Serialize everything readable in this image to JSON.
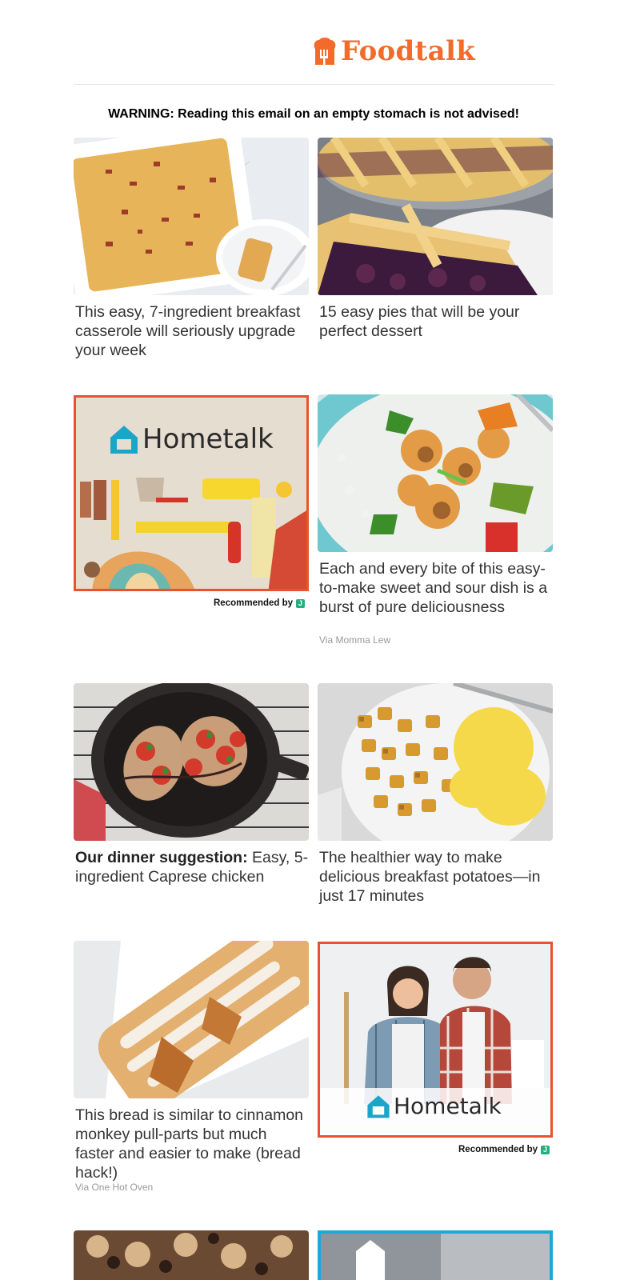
{
  "brand": {
    "name": "Foodtalk",
    "color": "#f26b2b"
  },
  "warning": "WARNING: Reading this email on an empty stomach is not advised!",
  "cards": {
    "casserole": {
      "title": "This easy, 7-ingredient breakfast casserole will seriously upgrade your week"
    },
    "pies": {
      "title": "15 easy pies that will be your perfect dessert"
    },
    "shrimp": {
      "title": "Each and every bite of this easy-to-make sweet and sour dish is a burst of pure deliciousness",
      "via": "Via Momma Lew"
    },
    "chicken": {
      "title_bold": "Our dinner suggestion:",
      "title_rest": " Easy, 5-ingredient Caprese chicken"
    },
    "potatoes": {
      "title": "The healthier way to make delicious breakfast potatoes—in just 17 minutes"
    },
    "bread": {
      "title": "This bread is similar to cinnamon monkey pull-parts but much faster and easier to make (bread hack!)",
      "via": "Via One Hot Oven"
    }
  },
  "ads": {
    "ad1": {
      "brand": "Hometalk",
      "recommended": "Recommended by"
    },
    "ad2": {
      "brand": "Hometalk",
      "recommended": "Recommended by"
    }
  },
  "colors": {
    "ad_border": "#e8532f",
    "ad_border_blue": "#1ea7d8",
    "hometalk_teal": "#1aa6c8"
  }
}
